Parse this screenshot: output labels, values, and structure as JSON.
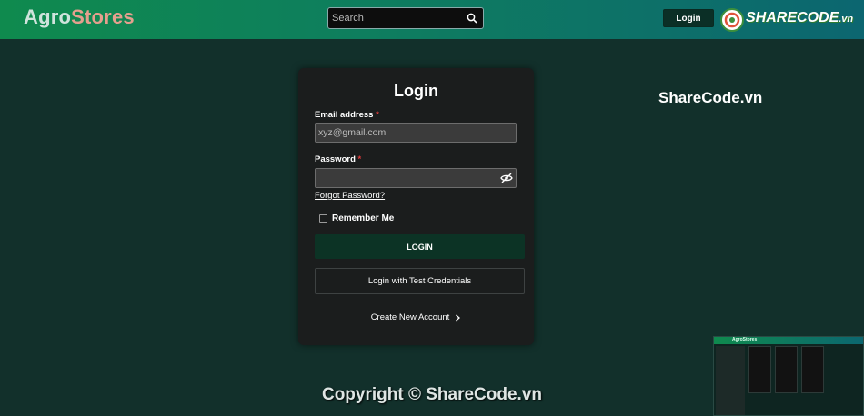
{
  "header": {
    "logo_part1": "Agro",
    "logo_part2": "Stores",
    "search_placeholder": "Search",
    "login_button": "Login",
    "brand_badge": "SHARECODE",
    "brand_badge_suffix": ".vn"
  },
  "watermarks": {
    "right": "ShareCode.vn",
    "footer": "Copyright © ShareCode.vn"
  },
  "form": {
    "title": "Login",
    "email_label": "Email address",
    "email_placeholder": "xyz@gmail.com",
    "password_label": "Password",
    "required_mark": "*",
    "forgot_link": "Forgot Password?",
    "remember_label": "Remember Me",
    "login_button": "LOGIN",
    "test_credentials_button": "Login with Test Credentials",
    "create_account_link": "Create New Account"
  },
  "thumbnail": {
    "logo": "AgroStores"
  },
  "colors": {
    "page_bg": "#12302b",
    "header_start": "#0f8a4e",
    "header_end": "#0c6670",
    "card_bg": "#1b1d1d",
    "login_button_bg": "#0c3325",
    "required": "#e23a3a"
  }
}
